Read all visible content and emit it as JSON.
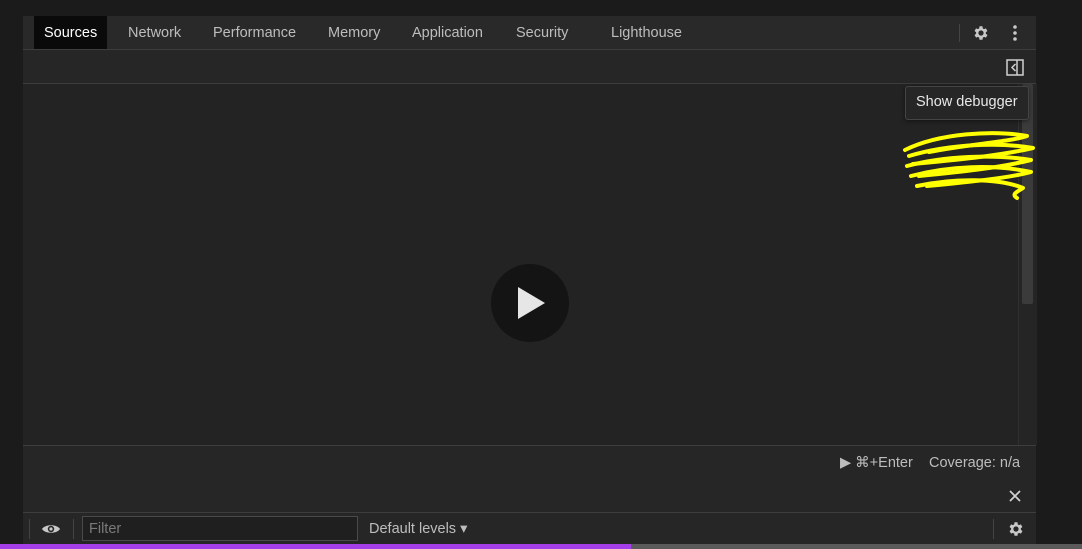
{
  "tabs": [
    {
      "label": "Sources",
      "active": true
    },
    {
      "label": "Network",
      "active": false
    },
    {
      "label": "Performance",
      "active": false
    },
    {
      "label": "Memory",
      "active": false
    },
    {
      "label": "Application",
      "active": false
    },
    {
      "label": "Security",
      "active": false
    },
    {
      "label": "Lighthouse",
      "active": false
    }
  ],
  "toolbar": {
    "settings_icon": "gear-icon",
    "more_icon": "kebab-menu-icon",
    "show_debugger_icon": "show-debugger-icon"
  },
  "tooltip": {
    "text": "Show debugger"
  },
  "editor": {
    "play_icon": "play-icon"
  },
  "annotation": {
    "color": "#ffff00"
  },
  "statusbar": {
    "run_hint": "▶ ⌘+Enter",
    "coverage": "Coverage: n/a"
  },
  "drawer": {
    "close_icon": "close-icon"
  },
  "console": {
    "eye_icon": "eye-icon",
    "filter_placeholder": "Filter",
    "filter_value": "",
    "levels_label": "Default levels ▾",
    "settings_icon": "gear-icon"
  },
  "progress": {
    "value": 0.583,
    "color": "#a43ee8"
  },
  "colors": {
    "active_tab_bg": "#0a0a0a",
    "panel_bg": "#242424"
  }
}
